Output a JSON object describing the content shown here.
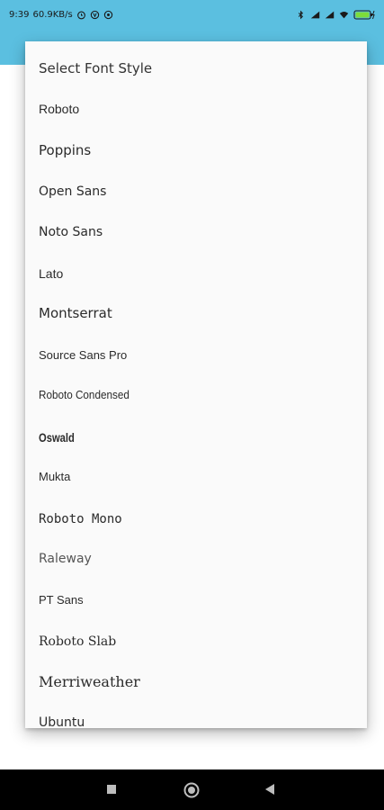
{
  "status_bar": {
    "time": "9:39",
    "network_speed": "60.9KB/s",
    "left_icons": [
      "alarm-icon",
      "vpn-icon",
      "sync-icon"
    ],
    "right_icons": [
      "bluetooth-icon",
      "signal-icon",
      "signal-icon",
      "wifi-icon",
      "battery-charging-icon"
    ]
  },
  "colors": {
    "app_bar": "#5bbfe0",
    "menu_background": "#fafafa",
    "text": "#2b2b2b",
    "nav_bar": "#000000"
  },
  "menu": {
    "title": "Select Font Style",
    "items": [
      "Roboto",
      "Poppins",
      "Open Sans",
      "Noto Sans",
      "Lato",
      "Montserrat",
      "Source Sans Pro",
      "Roboto Condensed",
      "Oswald",
      "Mukta",
      "Roboto Mono",
      "Raleway",
      "PT Sans",
      "Roboto Slab",
      "Merriweather",
      "Ubuntu"
    ]
  },
  "nav_bar": {
    "buttons": [
      "recents-square-icon",
      "home-circle-icon",
      "back-triangle-icon"
    ]
  }
}
